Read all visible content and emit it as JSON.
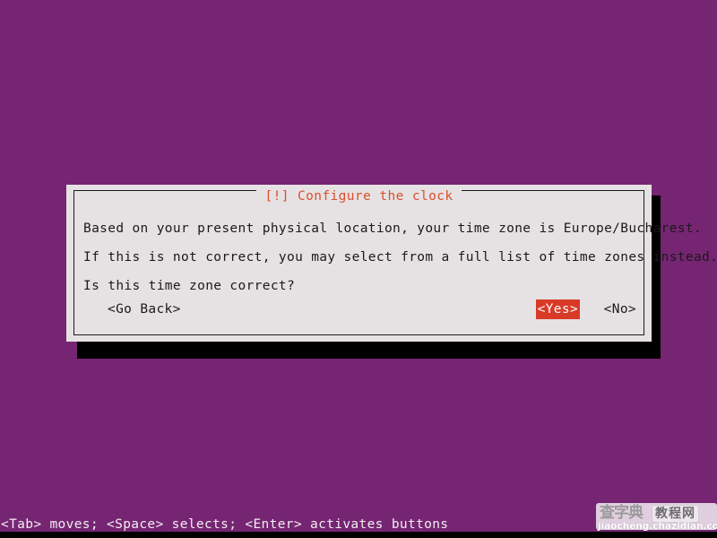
{
  "screen": {
    "background_color": "#762572",
    "bottom_bar_color": "#000000"
  },
  "dialog": {
    "title": "[!] Configure the clock",
    "title_color": "#d94f2b",
    "background_color": "#e6e2e4",
    "border_color": "#1a1a1a",
    "shadow_color": "#000000",
    "lines": [
      "Based on your present physical location, your time zone is Europe/Bucharest.",
      "If this is not correct, you may select from a full list of time zones instead.",
      "Is this time zone correct?"
    ],
    "buttons": {
      "go_back": "<Go Back>",
      "yes": "<Yes>",
      "no": "<No>",
      "selected": "<Yes>",
      "selected_bg": "#d93a26",
      "selected_fg": "#ffffff"
    }
  },
  "status_bar": {
    "text": "<Tab> moves; <Space> selects; <Enter> activates buttons",
    "color": "#f2eef2"
  },
  "watermark": {
    "logo": "查字典",
    "sub": "教程网",
    "url": "jiaocheng.chazidian.com"
  }
}
